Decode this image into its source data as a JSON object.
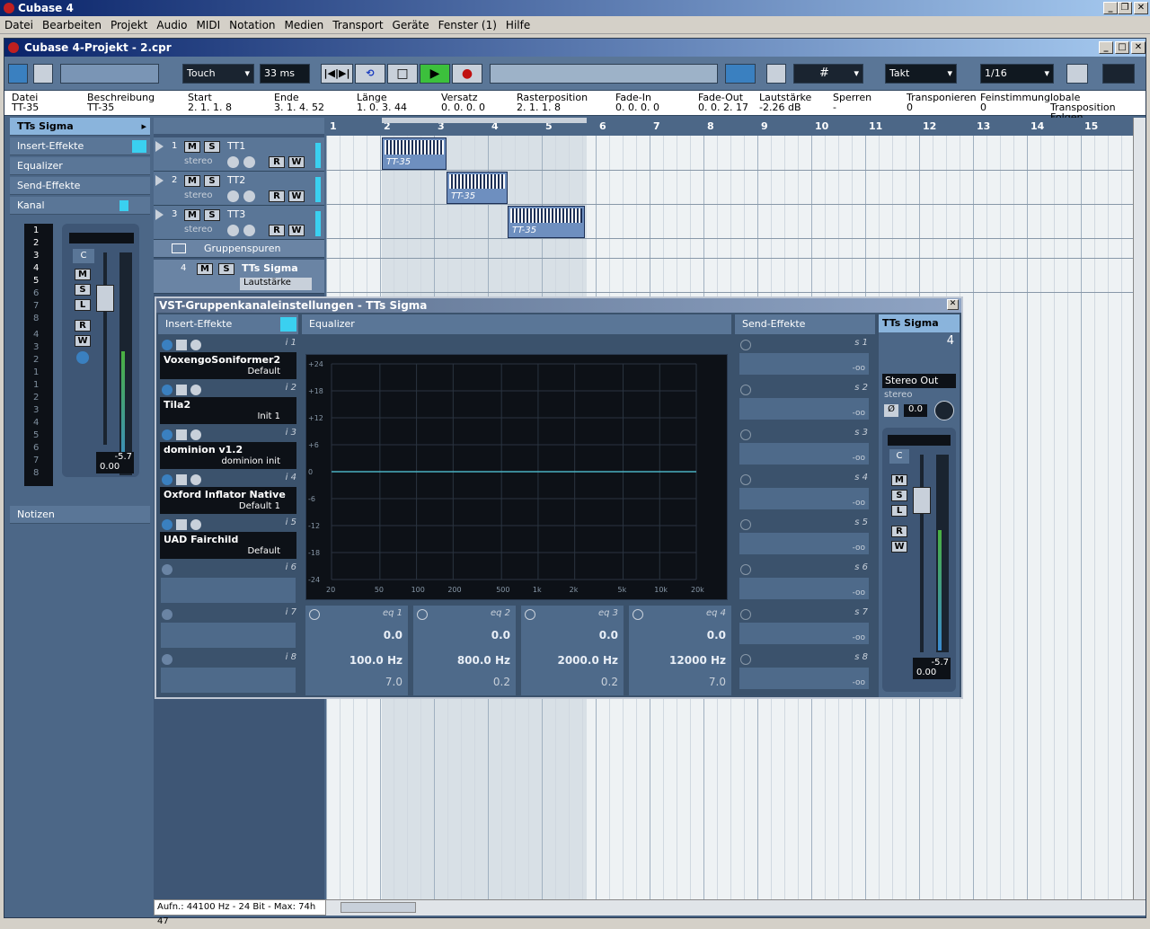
{
  "app": {
    "title": "Cubase 4"
  },
  "menu": [
    "Datei",
    "Bearbeiten",
    "Projekt",
    "Audio",
    "MIDI",
    "Notation",
    "Medien",
    "Transport",
    "Geräte",
    "Fenster (1)",
    "Hilfe"
  ],
  "project": {
    "title": "Cubase 4-Projekt - 2.cpr"
  },
  "toolbar": {
    "automation_mode": "Touch",
    "latency": "33 ms",
    "quantize": "1/16",
    "snap": "Takt"
  },
  "infoline": {
    "headers": [
      "Datei",
      "Beschreibung",
      "Start",
      "Ende",
      "Länge",
      "Versatz",
      "Rasterposition",
      "Fade-In",
      "Fade-Out",
      "Lautstärke",
      "Sperren",
      "Transponieren",
      "Feinstimmung",
      "lobale Transposition"
    ],
    "values": [
      "TT-35",
      "TT-35",
      "2. 1. 1.   8",
      "3. 1. 4. 52",
      "1. 0. 3. 44",
      "0. 0. 0.   0",
      "2. 1. 1.   8",
      "0. 0. 0.   0",
      "0. 0. 2. 17",
      "-2.26 dB",
      "-",
      "0",
      "0",
      "Folgen"
    ]
  },
  "inspector": {
    "track_name": "TTs Sigma",
    "sections": [
      "Insert-Effekte",
      "Equalizer",
      "Send-Effekte",
      "Kanal"
    ],
    "notes": "Notizen",
    "fader_value": "-5.7",
    "fader_pos": "0.00",
    "pan": "C",
    "channel_numbers_top": [
      "1",
      "2",
      "3",
      "4",
      "5",
      "6",
      "7",
      "8"
    ],
    "channel_numbers_bottom": [
      "4",
      "3",
      "2",
      "1",
      "1",
      "2",
      "3",
      "4",
      "5",
      "6",
      "7",
      "8"
    ]
  },
  "tracks": [
    {
      "num": "1",
      "name": "TT1",
      "type": "stereo"
    },
    {
      "num": "2",
      "name": "TT2",
      "type": "stereo"
    },
    {
      "num": "3",
      "name": "TT3",
      "type": "stereo"
    }
  ],
  "group_folder": {
    "label": "Gruppenspuren"
  },
  "group_track": {
    "num": "4",
    "name": "TTs Sigma",
    "param": "Lautstärke"
  },
  "ruler": [
    "1",
    "2",
    "3",
    "4",
    "5",
    "6",
    "7",
    "8",
    "9",
    "10",
    "11",
    "12",
    "13",
    "14",
    "15"
  ],
  "clips": [
    {
      "label": "TT-35"
    },
    {
      "label": "TT-35"
    },
    {
      "label": "TT-35"
    }
  ],
  "status": {
    "text": "Aufn.: 44100 Hz - 24 Bit - Max: 74h 47"
  },
  "vst": {
    "title": "VST-Gruppenkanaleinstellungen - TTs Sigma",
    "insert_header": "Insert-Effekte",
    "eq_header": "Equalizer",
    "send_header": "Send-Effekte",
    "channel_name": "TTs Sigma",
    "channel_num": "4",
    "output": "Stereo Out",
    "output_type": "stereo",
    "phase_value": "0.0",
    "pan": "C",
    "fader_value": "-5.7",
    "fader_pos": "0.00",
    "inserts": [
      {
        "slot": "i 1",
        "name": "VoxengoSoniformer2",
        "preset": "Default"
      },
      {
        "slot": "i 2",
        "name": "Tila2",
        "preset": "Init 1"
      },
      {
        "slot": "i 3",
        "name": "dominion v1.2",
        "preset": "dominion init"
      },
      {
        "slot": "i 4",
        "name": "Oxford Inflator Native",
        "preset": "Default 1"
      },
      {
        "slot": "i 5",
        "name": "UAD Fairchild",
        "preset": "Default"
      },
      {
        "slot": "i 6"
      },
      {
        "slot": "i 7"
      },
      {
        "slot": "i 8"
      }
    ],
    "eq_db_ticks": [
      "+24",
      "+18",
      "+12",
      "+6",
      "0",
      "-6",
      "-12",
      "-18",
      "-24"
    ],
    "eq_freq_ticks": [
      "20",
      "50",
      "100",
      "200",
      "500",
      "1k",
      "2k",
      "5k",
      "10k",
      "20k"
    ],
    "eq_bands": [
      {
        "name": "eq 1",
        "gain": "0.0",
        "freq": "100.0 Hz",
        "q": "7.0"
      },
      {
        "name": "eq 2",
        "gain": "0.0",
        "freq": "800.0 Hz",
        "q": "0.2"
      },
      {
        "name": "eq 3",
        "gain": "0.0",
        "freq": "2000.0 Hz",
        "q": "0.2"
      },
      {
        "name": "eq 4",
        "gain": "0.0",
        "freq": "12000 Hz",
        "q": "7.0"
      }
    ],
    "sends": [
      {
        "slot": "s 1",
        "value": "-oo"
      },
      {
        "slot": "s 2",
        "value": "-oo"
      },
      {
        "slot": "s 3",
        "value": "-oo"
      },
      {
        "slot": "s 4",
        "value": "-oo"
      },
      {
        "slot": "s 5",
        "value": "-oo"
      },
      {
        "slot": "s 6",
        "value": "-oo"
      },
      {
        "slot": "s 7",
        "value": "-oo"
      },
      {
        "slot": "s 8",
        "value": "-oo"
      }
    ]
  },
  "colors": {
    "panel": "#4c6787",
    "accent": "#3ad0f0",
    "titlebar": "#0a246a"
  }
}
